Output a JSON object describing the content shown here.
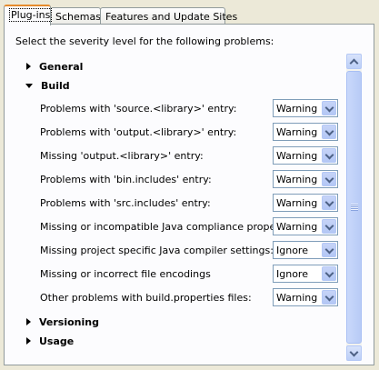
{
  "tabs": [
    {
      "label": "Plug-ins",
      "active": true
    },
    {
      "label": "Schemas",
      "active": false
    },
    {
      "label": "Features and Update Sites",
      "active": false
    }
  ],
  "intro": "Select the severity level for the following problems:",
  "sections": {
    "general": "General",
    "build": "Build",
    "versioning": "Versioning",
    "usage": "Usage"
  },
  "rows": [
    {
      "label": "Problems with 'source.<library>' entry:",
      "value": "Warning"
    },
    {
      "label": "Problems with 'output.<library>' entry:",
      "value": "Warning"
    },
    {
      "label": "Missing 'output.<library>' entry:",
      "value": "Warning"
    },
    {
      "label": "Problems with 'bin.includes' entry:",
      "value": "Warning"
    },
    {
      "label": "Problems with 'src.includes' entry:",
      "value": "Warning"
    },
    {
      "label": "Missing or incompatible Java compliance properties:",
      "value": "Warning"
    },
    {
      "label": "Missing project specific Java compiler settings:",
      "value": "Ignore"
    },
    {
      "label": "Missing or incorrect file encodings",
      "value": "Ignore"
    },
    {
      "label": "Other problems with build.properties files:",
      "value": "Warning"
    }
  ]
}
